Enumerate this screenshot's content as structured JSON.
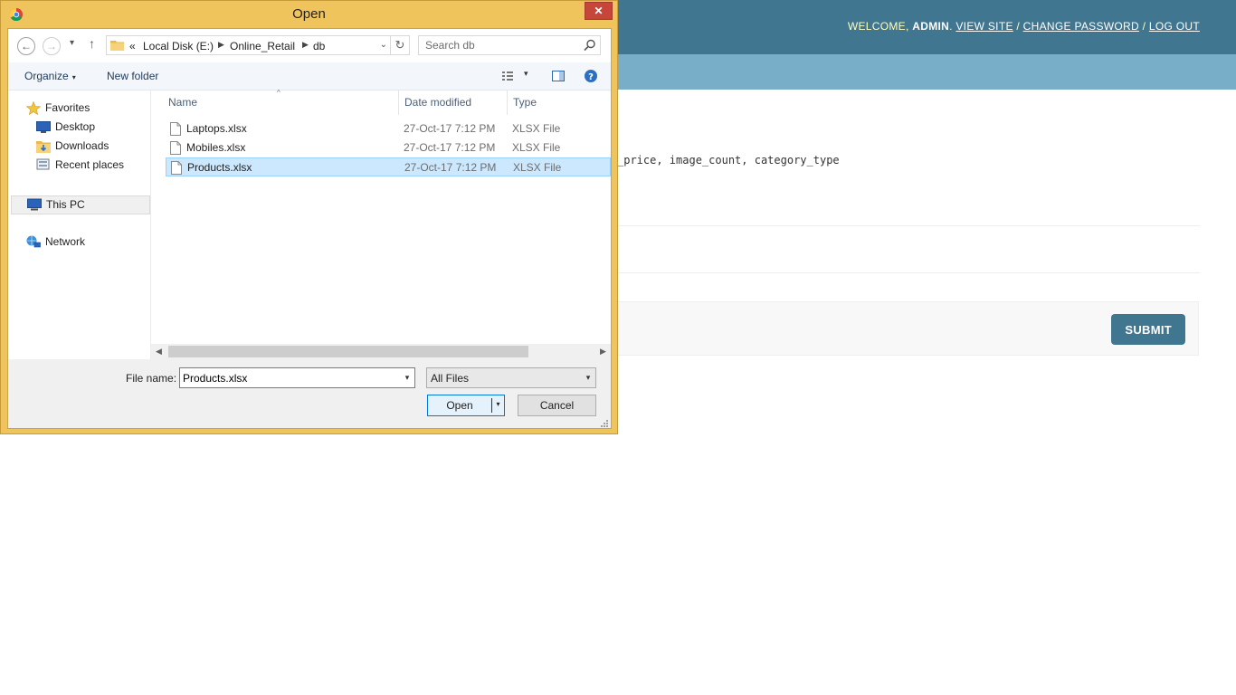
{
  "admin": {
    "welcome": "WELCOME,",
    "username": "ADMIN",
    "sep_after_user": ".",
    "view_site": "VIEW SITE",
    "slash1": "/",
    "change_password": "CHANGE PASSWORD",
    "slash2": "/",
    "log_out": "LOG OUT",
    "help_text": "_price, image_count, category_type",
    "submit": "SUBMIT",
    "colors": {
      "header": "#417690",
      "breadcrumbs": "#79aec8"
    }
  },
  "dialog": {
    "title": "Open",
    "close_glyph": "✕",
    "nav": {
      "back_glyph": "←",
      "forward_glyph": "→",
      "recent_glyph": "▾",
      "up_glyph": "↑"
    },
    "address": {
      "chevron": "«",
      "parts": [
        "Local Disk (E:)",
        "Online_Retail",
        "db"
      ],
      "sep": "▶",
      "dropdown_glyph": "⌄",
      "refresh_glyph": "↻"
    },
    "search_placeholder": "Search db",
    "toolbar": {
      "organize": "Organize",
      "arrow": "▾",
      "new_folder": "New folder"
    },
    "nav_pane": {
      "favorites": "Favorites",
      "desktop": "Desktop",
      "downloads": "Downloads",
      "recent_places": "Recent places",
      "this_pc": "This PC",
      "network": "Network"
    },
    "columns": {
      "name": "Name",
      "date_modified": "Date modified",
      "type": "Type",
      "sort_glyph": "^"
    },
    "files": [
      {
        "name": "Laptops.xlsx",
        "date": "27-Oct-17 7:12 PM",
        "type": "XLSX File",
        "selected": false
      },
      {
        "name": "Mobiles.xlsx",
        "date": "27-Oct-17 7:12 PM",
        "type": "XLSX File",
        "selected": false
      },
      {
        "name": "Products.xlsx",
        "date": "27-Oct-17 7:12 PM",
        "type": "XLSX File",
        "selected": true
      }
    ],
    "scroll": {
      "left_glyph": "◀",
      "right_glyph": "▶"
    },
    "file_name_label": "File name:",
    "file_name_value": "Products.xlsx",
    "combo_arrow": "▾",
    "filter_value": "All Files",
    "open_button": "Open",
    "cancel_button": "Cancel",
    "colors": {
      "frame": "#f0c45c",
      "close": "#c7463a",
      "selection": "#cce8ff"
    }
  }
}
